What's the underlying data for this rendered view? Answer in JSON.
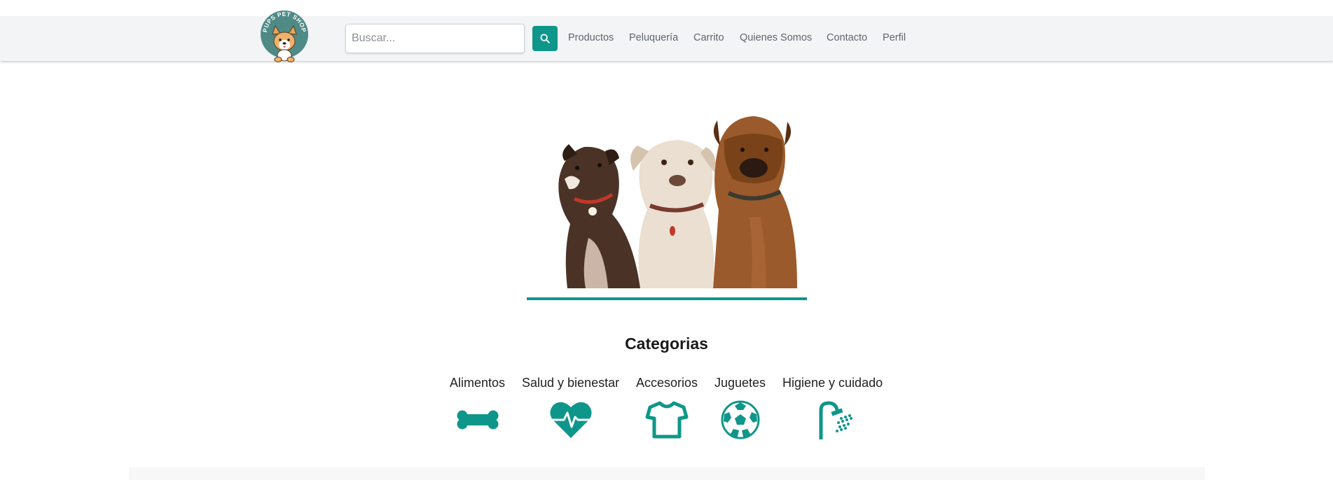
{
  "header": {
    "logo_text": "PUPS PET SHOP",
    "search": {
      "placeholder": "Buscar...",
      "value": ""
    },
    "search_button_icon": "search-icon",
    "nav": [
      {
        "label": "Productos"
      },
      {
        "label": "Peluquería"
      },
      {
        "label": "Carrito"
      },
      {
        "label": "Quienes Somos"
      },
      {
        "label": "Contacto"
      },
      {
        "label": "Perfil"
      }
    ]
  },
  "hero": {
    "image": "three-dogs-photo"
  },
  "categories": {
    "title": "Categorias",
    "items": [
      {
        "label": "Alimentos",
        "icon": "bone-icon"
      },
      {
        "label": "Salud y bienestar",
        "icon": "heart-pulse-icon"
      },
      {
        "label": "Accesorios",
        "icon": "tshirt-icon"
      },
      {
        "label": "Juguetes",
        "icon": "soccer-ball-icon"
      },
      {
        "label": "Higiene y cuidado",
        "icon": "shower-icon"
      }
    ]
  },
  "colors": {
    "accent": "#0f968a",
    "navbar_bg": "#f3f4f6",
    "nav_text": "#5e6670",
    "logo_bg": "#4f8a86"
  }
}
